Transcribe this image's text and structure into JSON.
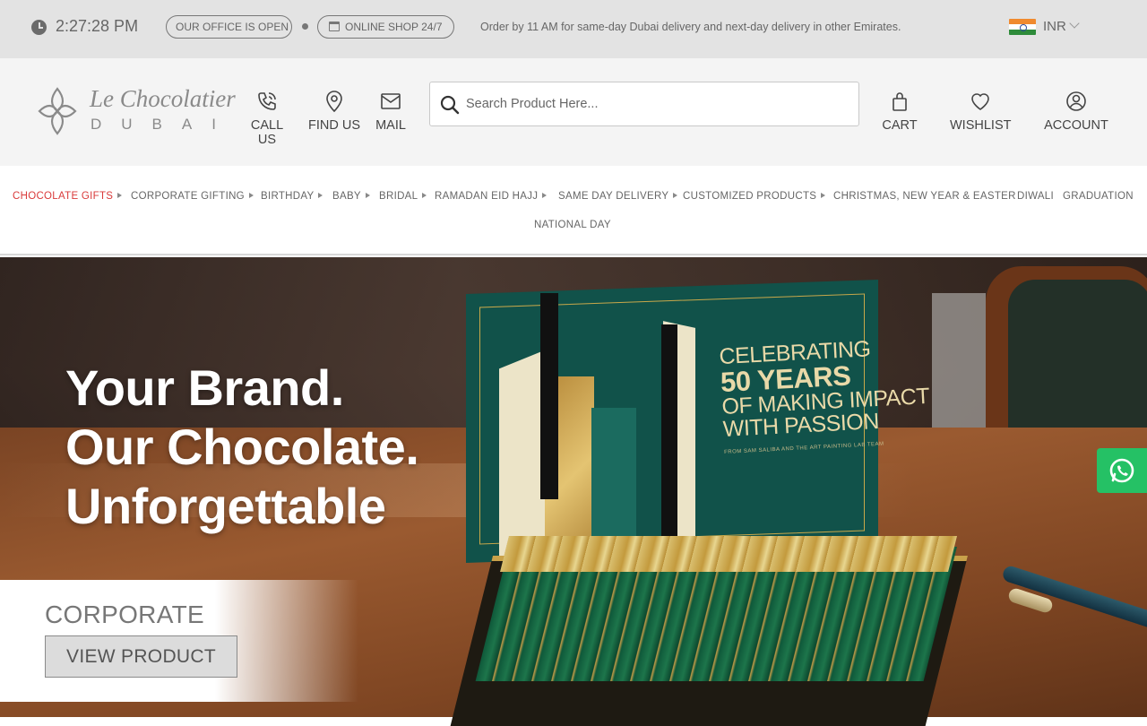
{
  "topbar": {
    "clock_icon": "clock-icon",
    "time": "2:27:28 PM",
    "office_status": "OUR OFFICE IS OPEN",
    "shop_status": "ONLINE SHOP 24/7",
    "shop_icon": "store-icon",
    "message": "Order by 11 AM for same-day Dubai delivery and next-day delivery in other Emirates.",
    "currency": "INR",
    "currency_flag": "india-flag-icon"
  },
  "header": {
    "logo_script": "Le Chocolatier",
    "logo_sub": "DUBAI",
    "links": {
      "call": {
        "label": "CALL US",
        "icon": "phone-icon"
      },
      "find": {
        "label": "FIND US",
        "icon": "location-pin-icon"
      },
      "mail": {
        "label": "MAIL",
        "icon": "envelope-icon"
      },
      "cart": {
        "label": "CART",
        "icon": "shopping-bag-icon"
      },
      "wishlist": {
        "label": "WISHLIST",
        "icon": "heart-icon"
      },
      "account": {
        "label": "ACCOUNT",
        "icon": "user-circle-icon"
      }
    },
    "search": {
      "placeholder": "Search Product Here...",
      "value": ""
    }
  },
  "nav": {
    "items": [
      {
        "label": "CHOCOLATE GIFTS",
        "active": true,
        "has_arrow": true
      },
      {
        "label": "CORPORATE GIFTING",
        "active": false,
        "has_arrow": true
      },
      {
        "label": "BIRTHDAY",
        "active": false,
        "has_arrow": true
      },
      {
        "label": "BABY",
        "active": false,
        "has_arrow": true
      },
      {
        "label": "BRIDAL",
        "active": false,
        "has_arrow": true
      },
      {
        "label": "RAMADAN EID HAJJ",
        "active": false,
        "has_arrow": true
      },
      {
        "label": "SAME DAY DELIVERY",
        "active": false,
        "has_arrow": true
      },
      {
        "label": "CUSTOMIZED PRODUCTS",
        "active": false,
        "has_arrow": true
      },
      {
        "label": "CHRISTMAS, NEW YEAR & EASTER",
        "active": false,
        "has_arrow": false
      },
      {
        "label": "DIWALI",
        "active": false,
        "has_arrow": false
      },
      {
        "label": "GRADUATION",
        "active": false,
        "has_arrow": false
      },
      {
        "label": "NATIONAL DAY",
        "active": false,
        "has_arrow": false
      }
    ],
    "active_color": "#d93a3a"
  },
  "hero": {
    "headline": [
      "Your Brand.",
      "Our Chocolate.",
      "Unforgettable"
    ],
    "board_text": [
      "CELEBRATING",
      "50 YEARS",
      "OF MAKING IMPACT",
      "WITH PASSION"
    ],
    "board_small": "FROM SAM SALIBA AND THE ART PAINTING LAB TEAM",
    "caption": "CORPORATE",
    "button_label": "VIEW PRODUCT"
  },
  "floating": {
    "whatsapp_icon": "whatsapp-icon",
    "whatsapp_color": "#25c165"
  }
}
